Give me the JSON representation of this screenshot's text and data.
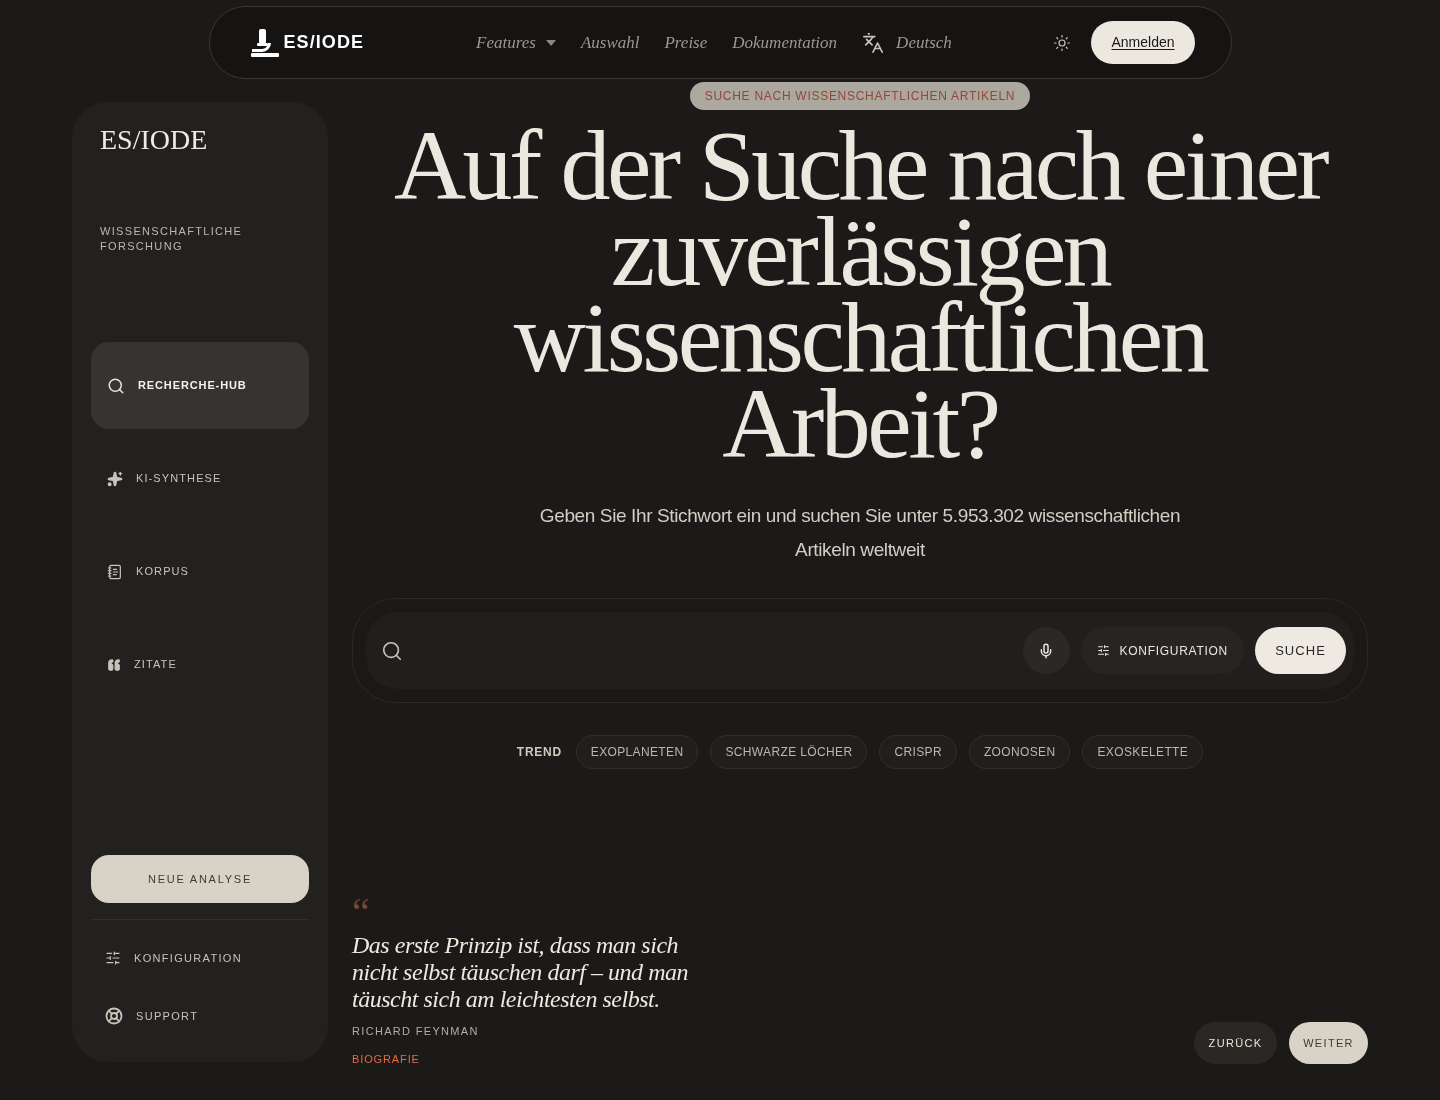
{
  "header": {
    "logo": "ES/IODE",
    "nav": [
      {
        "label": "Features",
        "kind": "dropdown"
      },
      {
        "label": "Auswahl",
        "kind": "link"
      },
      {
        "label": "Preise",
        "kind": "link"
      },
      {
        "label": "Dokumentation",
        "kind": "link"
      },
      {
        "label": "Deutsch",
        "kind": "language"
      }
    ],
    "login_button": "Anmelden"
  },
  "sidebar": {
    "brand": "ES/IODE",
    "tagline": "WISSENSCHAFTLICHE FORSCHUNG",
    "items": [
      {
        "label": "RECHERCHE-HUB",
        "selected": true
      },
      {
        "label": "KI-SYNTHESE",
        "selected": false
      },
      {
        "label": "KORPUS",
        "selected": false
      },
      {
        "label": "ZITATE",
        "selected": false
      }
    ],
    "new_analysis_button": "NEUE ANALYSE",
    "footer_items": [
      "KONFIGURATION",
      "SUPPORT"
    ]
  },
  "hero": {
    "badge": "SUCHE NACH WISSENSCHAFTLICHEN ARTIKELN",
    "heading": "Auf der Suche nach einer zuverlässigen wissenschaftlichen Arbeit?",
    "subtitle": "Geben Sie Ihr Stichwort ein und suchen Sie unter 5.953.302 wissenschaftlichen Artikeln weltweit"
  },
  "search": {
    "config_button": "KONFIGURATION",
    "submit_button": "SUCHE"
  },
  "trending": {
    "label": "TREND",
    "tags": [
      "EXOPLANETEN",
      "SCHWARZE LÖCHER",
      "CRISPR",
      "ZOONOSEN",
      "EXOSKELETTE"
    ]
  },
  "quote": {
    "mark": "“",
    "text": "Das erste Prinzip ist, dass man sich nicht selbst täuschen darf – und man täuscht sich am leichtesten selbst.",
    "author": "RICHARD FEYNMAN",
    "link": "BIOGRAFIE"
  },
  "pager": {
    "back": "ZURÜCK",
    "next": "WEITER"
  }
}
